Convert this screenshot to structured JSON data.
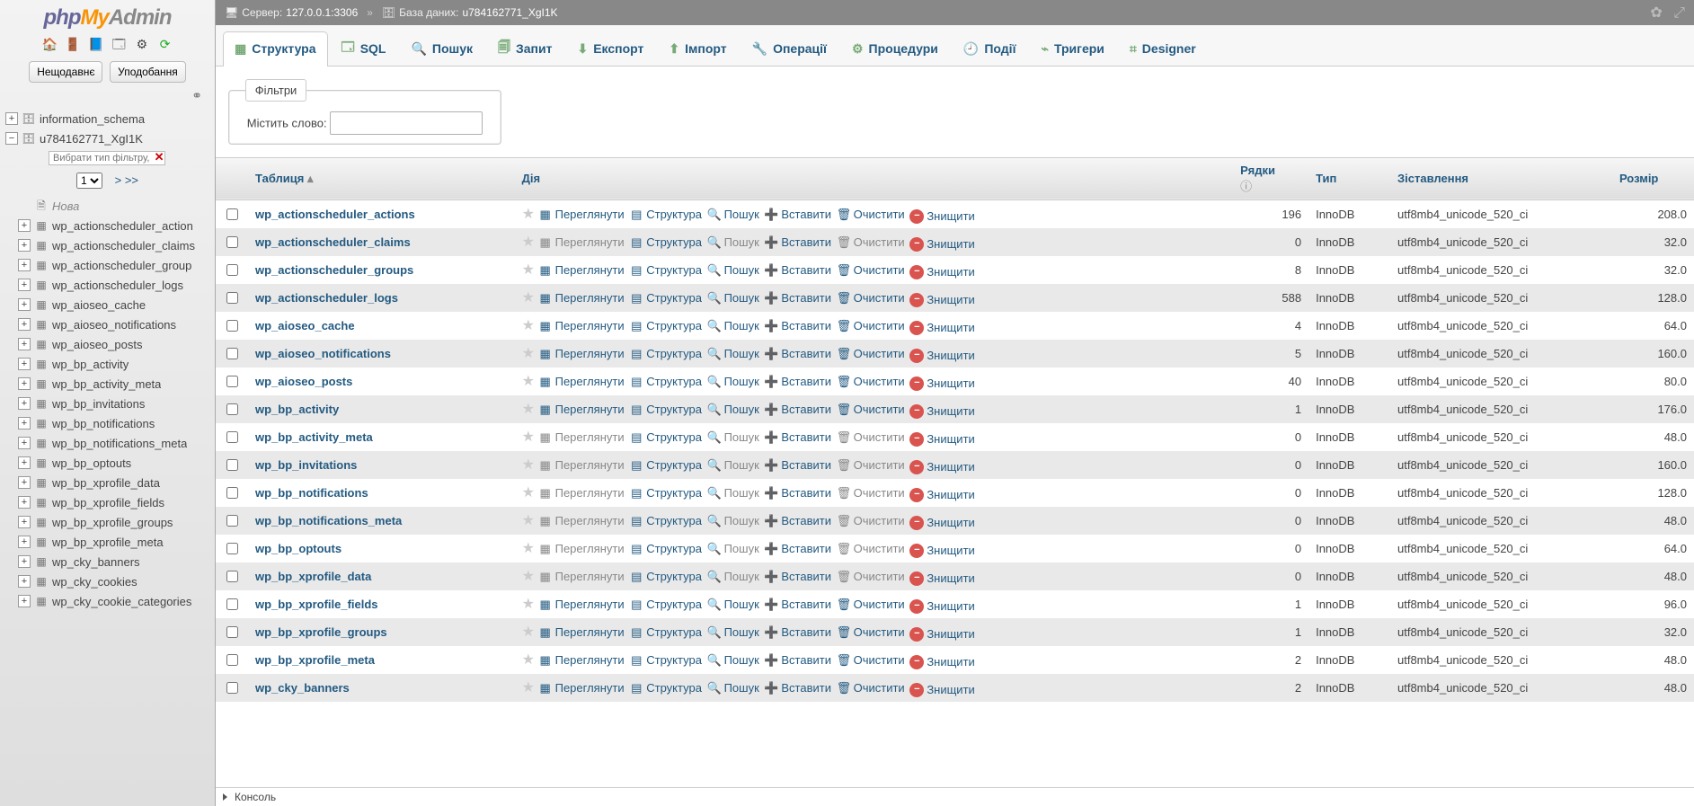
{
  "logo": {
    "p1": "php",
    "p2": "My",
    "p3": "Admin"
  },
  "nav_buttons": {
    "recent": "Нещодавнє",
    "favorites": "Уподобання"
  },
  "tree": {
    "db1": "information_schema",
    "db2": "u784162771_XgI1K",
    "filter_placeholder": "Вибрати тип фільтру, Enter u",
    "page_more": "> >>",
    "new": "Нова",
    "tables": [
      "wp_actionscheduler_action",
      "wp_actionscheduler_claims",
      "wp_actionscheduler_group",
      "wp_actionscheduler_logs",
      "wp_aioseo_cache",
      "wp_aioseo_notifications",
      "wp_aioseo_posts",
      "wp_bp_activity",
      "wp_bp_activity_meta",
      "wp_bp_invitations",
      "wp_bp_notifications",
      "wp_bp_notifications_meta",
      "wp_bp_optouts",
      "wp_bp_xprofile_data",
      "wp_bp_xprofile_fields",
      "wp_bp_xprofile_groups",
      "wp_bp_xprofile_meta",
      "wp_cky_banners",
      "wp_cky_cookies",
      "wp_cky_cookie_categories"
    ]
  },
  "crumbs": {
    "server_label": "Сервер:",
    "server_value": "127.0.0.1:3306",
    "db_label": "База даних:",
    "db_value": "u784162771_XgI1K"
  },
  "tabs": [
    {
      "id": "structure",
      "label": "Структура"
    },
    {
      "id": "sql",
      "label": "SQL"
    },
    {
      "id": "search",
      "label": "Пошук"
    },
    {
      "id": "query",
      "label": "Запит"
    },
    {
      "id": "export",
      "label": "Експорт"
    },
    {
      "id": "import",
      "label": "Імпорт"
    },
    {
      "id": "ops",
      "label": "Операції"
    },
    {
      "id": "routines",
      "label": "Процедури"
    },
    {
      "id": "events",
      "label": "Події"
    },
    {
      "id": "triggers",
      "label": "Тригери"
    },
    {
      "id": "designer",
      "label": "Designer"
    }
  ],
  "filters": {
    "legend": "Фільтри",
    "label": "Містить слово:"
  },
  "table_headers": {
    "table": "Таблиця",
    "action": "Дія",
    "rows": "Рядки",
    "type": "Тип",
    "collation": "Зіставлення",
    "size": "Розмір"
  },
  "ops": {
    "browse": "Переглянути",
    "structure": "Структура",
    "search": "Пошук",
    "insert": "Вставити",
    "empty": "Очистити",
    "drop": "Знищити"
  },
  "rows": [
    {
      "name": "wp_actionscheduler_actions",
      "rows": 196,
      "type": "InnoDB",
      "coll": "utf8mb4_unicode_520_ci",
      "size": "208.0"
    },
    {
      "name": "wp_actionscheduler_claims",
      "rows": 0,
      "type": "InnoDB",
      "coll": "utf8mb4_unicode_520_ci",
      "size": "32.0"
    },
    {
      "name": "wp_actionscheduler_groups",
      "rows": 8,
      "type": "InnoDB",
      "coll": "utf8mb4_unicode_520_ci",
      "size": "32.0"
    },
    {
      "name": "wp_actionscheduler_logs",
      "rows": 588,
      "type": "InnoDB",
      "coll": "utf8mb4_unicode_520_ci",
      "size": "128.0"
    },
    {
      "name": "wp_aioseo_cache",
      "rows": 4,
      "type": "InnoDB",
      "coll": "utf8mb4_unicode_520_ci",
      "size": "64.0"
    },
    {
      "name": "wp_aioseo_notifications",
      "rows": 5,
      "type": "InnoDB",
      "coll": "utf8mb4_unicode_520_ci",
      "size": "160.0"
    },
    {
      "name": "wp_aioseo_posts",
      "rows": 40,
      "type": "InnoDB",
      "coll": "utf8mb4_unicode_520_ci",
      "size": "80.0"
    },
    {
      "name": "wp_bp_activity",
      "rows": 1,
      "type": "InnoDB",
      "coll": "utf8mb4_unicode_520_ci",
      "size": "176.0"
    },
    {
      "name": "wp_bp_activity_meta",
      "rows": 0,
      "type": "InnoDB",
      "coll": "utf8mb4_unicode_520_ci",
      "size": "48.0"
    },
    {
      "name": "wp_bp_invitations",
      "rows": 0,
      "type": "InnoDB",
      "coll": "utf8mb4_unicode_520_ci",
      "size": "160.0"
    },
    {
      "name": "wp_bp_notifications",
      "rows": 0,
      "type": "InnoDB",
      "coll": "utf8mb4_unicode_520_ci",
      "size": "128.0"
    },
    {
      "name": "wp_bp_notifications_meta",
      "rows": 0,
      "type": "InnoDB",
      "coll": "utf8mb4_unicode_520_ci",
      "size": "48.0"
    },
    {
      "name": "wp_bp_optouts",
      "rows": 0,
      "type": "InnoDB",
      "coll": "utf8mb4_unicode_520_ci",
      "size": "64.0"
    },
    {
      "name": "wp_bp_xprofile_data",
      "rows": 0,
      "type": "InnoDB",
      "coll": "utf8mb4_unicode_520_ci",
      "size": "48.0"
    },
    {
      "name": "wp_bp_xprofile_fields",
      "rows": 1,
      "type": "InnoDB",
      "coll": "utf8mb4_unicode_520_ci",
      "size": "96.0"
    },
    {
      "name": "wp_bp_xprofile_groups",
      "rows": 1,
      "type": "InnoDB",
      "coll": "utf8mb4_unicode_520_ci",
      "size": "32.0"
    },
    {
      "name": "wp_bp_xprofile_meta",
      "rows": 2,
      "type": "InnoDB",
      "coll": "utf8mb4_unicode_520_ci",
      "size": "48.0"
    },
    {
      "name": "wp_cky_banners",
      "rows": 2,
      "type": "InnoDB",
      "coll": "utf8mb4_unicode_520_ci",
      "size": "48.0"
    }
  ],
  "console": "Консоль"
}
